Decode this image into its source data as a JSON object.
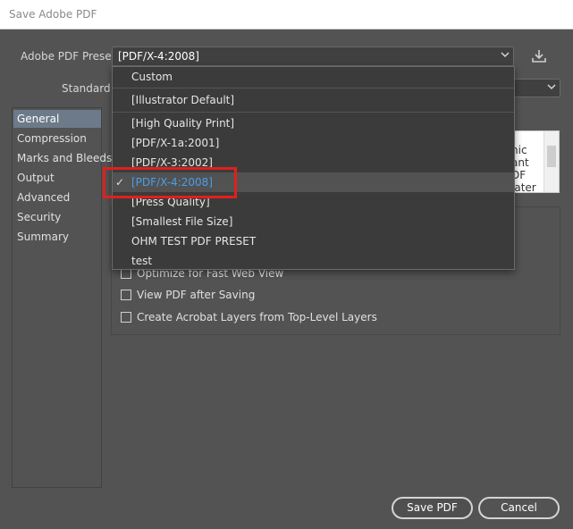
{
  "window": {
    "title": "Save Adobe PDF"
  },
  "preset": {
    "label": "Adobe PDF Preset:",
    "value": "[PDF/X-4:2008]",
    "chevron": "chevron-down-icon",
    "download_icon": "download-icon"
  },
  "standard": {
    "label": "Standard:"
  },
  "sidebar": {
    "items": [
      {
        "label": "General",
        "selected": true
      },
      {
        "label": "Compression"
      },
      {
        "label": "Marks and Bleeds"
      },
      {
        "label": "Output"
      },
      {
        "label": "Advanced"
      },
      {
        "label": "Security"
      },
      {
        "label": "Summary"
      }
    ]
  },
  "dropdown": {
    "items": [
      {
        "label": "Custom"
      },
      {
        "label": "[Illustrator Default]"
      },
      {
        "label": "[High Quality Print]"
      },
      {
        "label": "[PDF/X-1a:2001]"
      },
      {
        "label": "[PDF/X-3:2002]"
      },
      {
        "label": "[PDF/X-4:2008]",
        "selected": true
      },
      {
        "label": "[Press Quality]"
      },
      {
        "label": "[Smallest File Size]"
      },
      {
        "label": "OHM TEST PDF PRESET"
      },
      {
        "label": "test"
      }
    ],
    "check_glyph": "✓"
  },
  "description": {
    "text": "hic\nant\nDF\nlater"
  },
  "options": [
    {
      "label": "Optimize for Fast Web View",
      "checked": false
    },
    {
      "label": "View PDF after Saving",
      "checked": false
    },
    {
      "label": "Create Acrobat Layers from Top-Level Layers",
      "checked": false
    }
  ],
  "buttons": {
    "save": "Save PDF",
    "cancel": "Cancel"
  },
  "colors": {
    "background": "#535353",
    "dropdown_bg": "#3b3b3b",
    "selected_text": "#4a9ee8",
    "highlight": "#e0201b"
  }
}
